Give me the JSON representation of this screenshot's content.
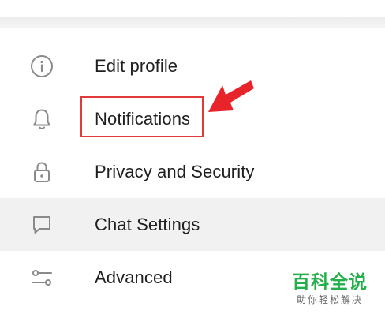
{
  "menu": {
    "items": [
      {
        "label": "Edit profile",
        "icon": "info-icon"
      },
      {
        "label": "Notifications",
        "icon": "bell-icon"
      },
      {
        "label": "Privacy and Security",
        "icon": "lock-icon"
      },
      {
        "label": "Chat Settings",
        "icon": "chat-bubble-icon"
      },
      {
        "label": "Advanced",
        "icon": "sliders-icon"
      }
    ],
    "active_item": "Chat Settings"
  },
  "annotation": {
    "highlight_target": "Notifications",
    "color": "#e23a3a"
  },
  "watermark": {
    "main": "百科全说",
    "sub": "助你轻松解决",
    "color": "#23b04a"
  }
}
